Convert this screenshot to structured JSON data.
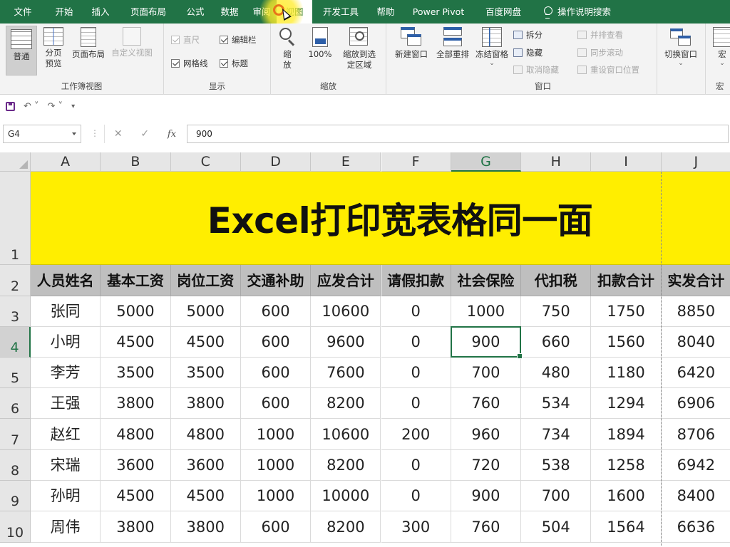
{
  "menu": {
    "items": [
      "文件",
      "开始",
      "插入",
      "页面布局",
      "公式",
      "数据",
      "审阅",
      "视图",
      "开发工具",
      "帮助",
      "Power Pivot",
      "百度网盘"
    ],
    "active_index": 7,
    "search_label": "操作说明搜索"
  },
  "ribbon": {
    "workbook_views": {
      "label": "工作簿视图",
      "normal": "普通",
      "page_break_preview": "分页预览",
      "page_layout": "页面布局",
      "custom_views": "自定义视图"
    },
    "show": {
      "label": "显示",
      "ruler": "直尺",
      "formula_bar": "编辑栏",
      "gridlines": "网格线",
      "headings": "标题"
    },
    "zoom": {
      "label": "缩放",
      "zoom": "缩放",
      "hundred": "100%",
      "zoom_to_selection": "缩放到选定区域"
    },
    "window": {
      "label": "窗口",
      "new_window": "新建窗口",
      "arrange_all": "全部重排",
      "freeze_panes": "冻结窗格",
      "split": "拆分",
      "hide": "隐藏",
      "unhide": "取消隐藏",
      "view_side_by_side": "并排查看",
      "sync_scroll": "同步滚动",
      "reset_position": "重设窗口位置",
      "switch_windows": "切换窗口"
    },
    "macros": {
      "label": "宏",
      "macros": "宏"
    }
  },
  "formula_bar": {
    "name_box": "G4",
    "value": "900"
  },
  "sheet": {
    "columns": [
      "A",
      "B",
      "C",
      "D",
      "E",
      "F",
      "G",
      "H",
      "I",
      "J"
    ],
    "selected_column": "G",
    "row_numbers": [
      "1",
      "2",
      "3",
      "4",
      "5",
      "6",
      "7",
      "8",
      "9",
      "10"
    ],
    "selected_row": "4",
    "title": "Excel打印宽表格同一面",
    "headers": [
      "人员姓名",
      "基本工资",
      "岗位工资",
      "交通补助",
      "应发合计",
      "请假扣款",
      "社会保险",
      "代扣税",
      "扣款合计",
      "实发合计"
    ],
    "rows": [
      [
        "张同",
        "5000",
        "5000",
        "600",
        "10600",
        "0",
        "1000",
        "750",
        "1750",
        "8850"
      ],
      [
        "小明",
        "4500",
        "4500",
        "600",
        "9600",
        "0",
        "900",
        "660",
        "1560",
        "8040"
      ],
      [
        "李芳",
        "3500",
        "3500",
        "600",
        "7600",
        "0",
        "700",
        "480",
        "1180",
        "6420"
      ],
      [
        "王强",
        "3800",
        "3800",
        "600",
        "8200",
        "0",
        "760",
        "534",
        "1294",
        "6906"
      ],
      [
        "赵红",
        "4800",
        "4800",
        "1000",
        "10600",
        "200",
        "960",
        "734",
        "1894",
        "8706"
      ],
      [
        "宋瑞",
        "3600",
        "3600",
        "1000",
        "8200",
        "0",
        "720",
        "538",
        "1258",
        "6942"
      ],
      [
        "孙明",
        "4500",
        "4500",
        "1000",
        "10000",
        "0",
        "900",
        "700",
        "1600",
        "8400"
      ],
      [
        "周伟",
        "3800",
        "3800",
        "600",
        "8200",
        "300",
        "760",
        "504",
        "1564",
        "6636"
      ]
    ]
  },
  "colors": {
    "excel_green": "#217346",
    "title_fill": "#ffee00",
    "header_fill": "#bfbfbf"
  }
}
